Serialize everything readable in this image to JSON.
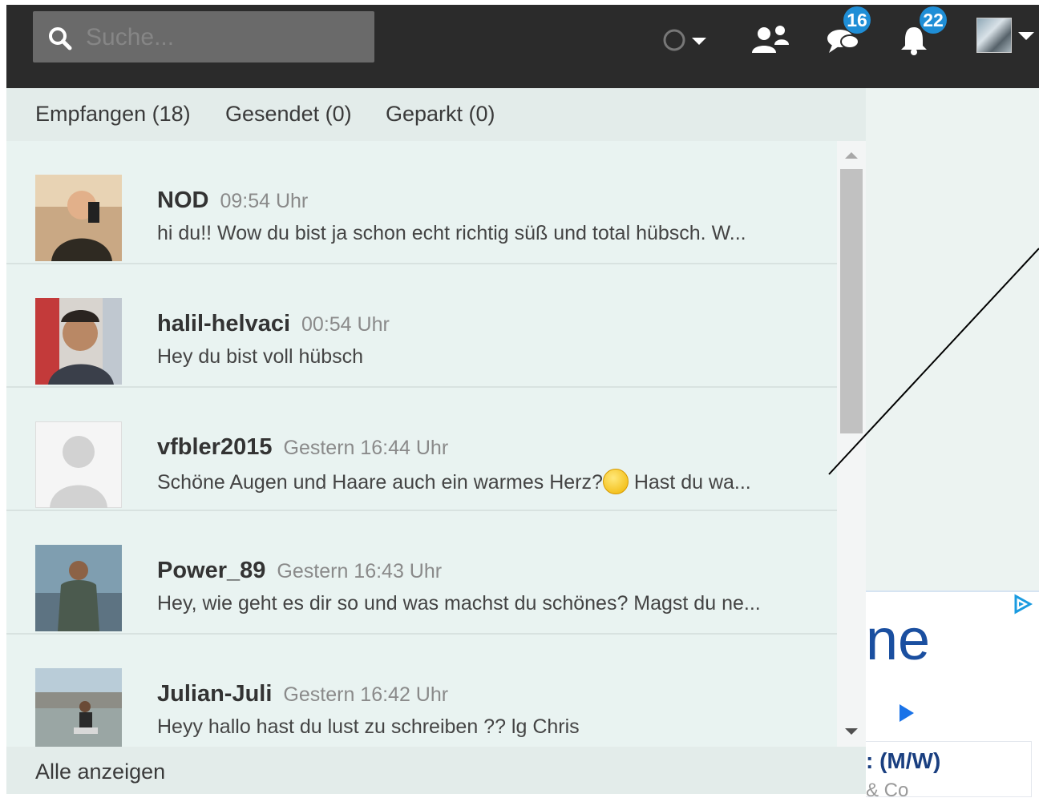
{
  "search": {
    "placeholder": "Suche..."
  },
  "topbar": {
    "status_icon": "status-circle-icon",
    "friends_icon": "users-icon",
    "messages_icon": "chat-bubbles-icon",
    "messages_badge": "16",
    "notifications_icon": "bell-icon",
    "notifications_badge": "22",
    "badge_color": "#1f8ed6"
  },
  "tabs": [
    {
      "label": "Empfangen (18)"
    },
    {
      "label": "Gesendet (0)"
    },
    {
      "label": "Geparkt (0)"
    }
  ],
  "messages": [
    {
      "name": "NOD",
      "time": "09:54 Uhr",
      "text": "hi du!! Wow du bist ja schon echt richtig süß und total hübsch. W..."
    },
    {
      "name": "halil-helvaci",
      "time": "00:54 Uhr",
      "text": "Hey du bist voll hübsch"
    },
    {
      "name": "vfbler2015",
      "time": "Gestern 16:44 Uhr",
      "text_before": "Schöne Augen und Haare auch ein warmes Herz?",
      "text_after": " Hast du wa..."
    },
    {
      "name": "Power_89",
      "time": "Gestern 16:43 Uhr",
      "text": "Hey, wie geht es dir so und was machst du schönes? Magst du ne..."
    },
    {
      "name": "Julian-Juli",
      "time": "Gestern 16:42 Uhr",
      "text": "Heyy hallo hast du lust zu schreiben ?? lg Chris"
    }
  ],
  "footer": {
    "label": "Alle anzeigen"
  },
  "ad": {
    "big_text": "ne",
    "sub_text": ": (M/W)",
    "sub_text2": "& Co"
  }
}
